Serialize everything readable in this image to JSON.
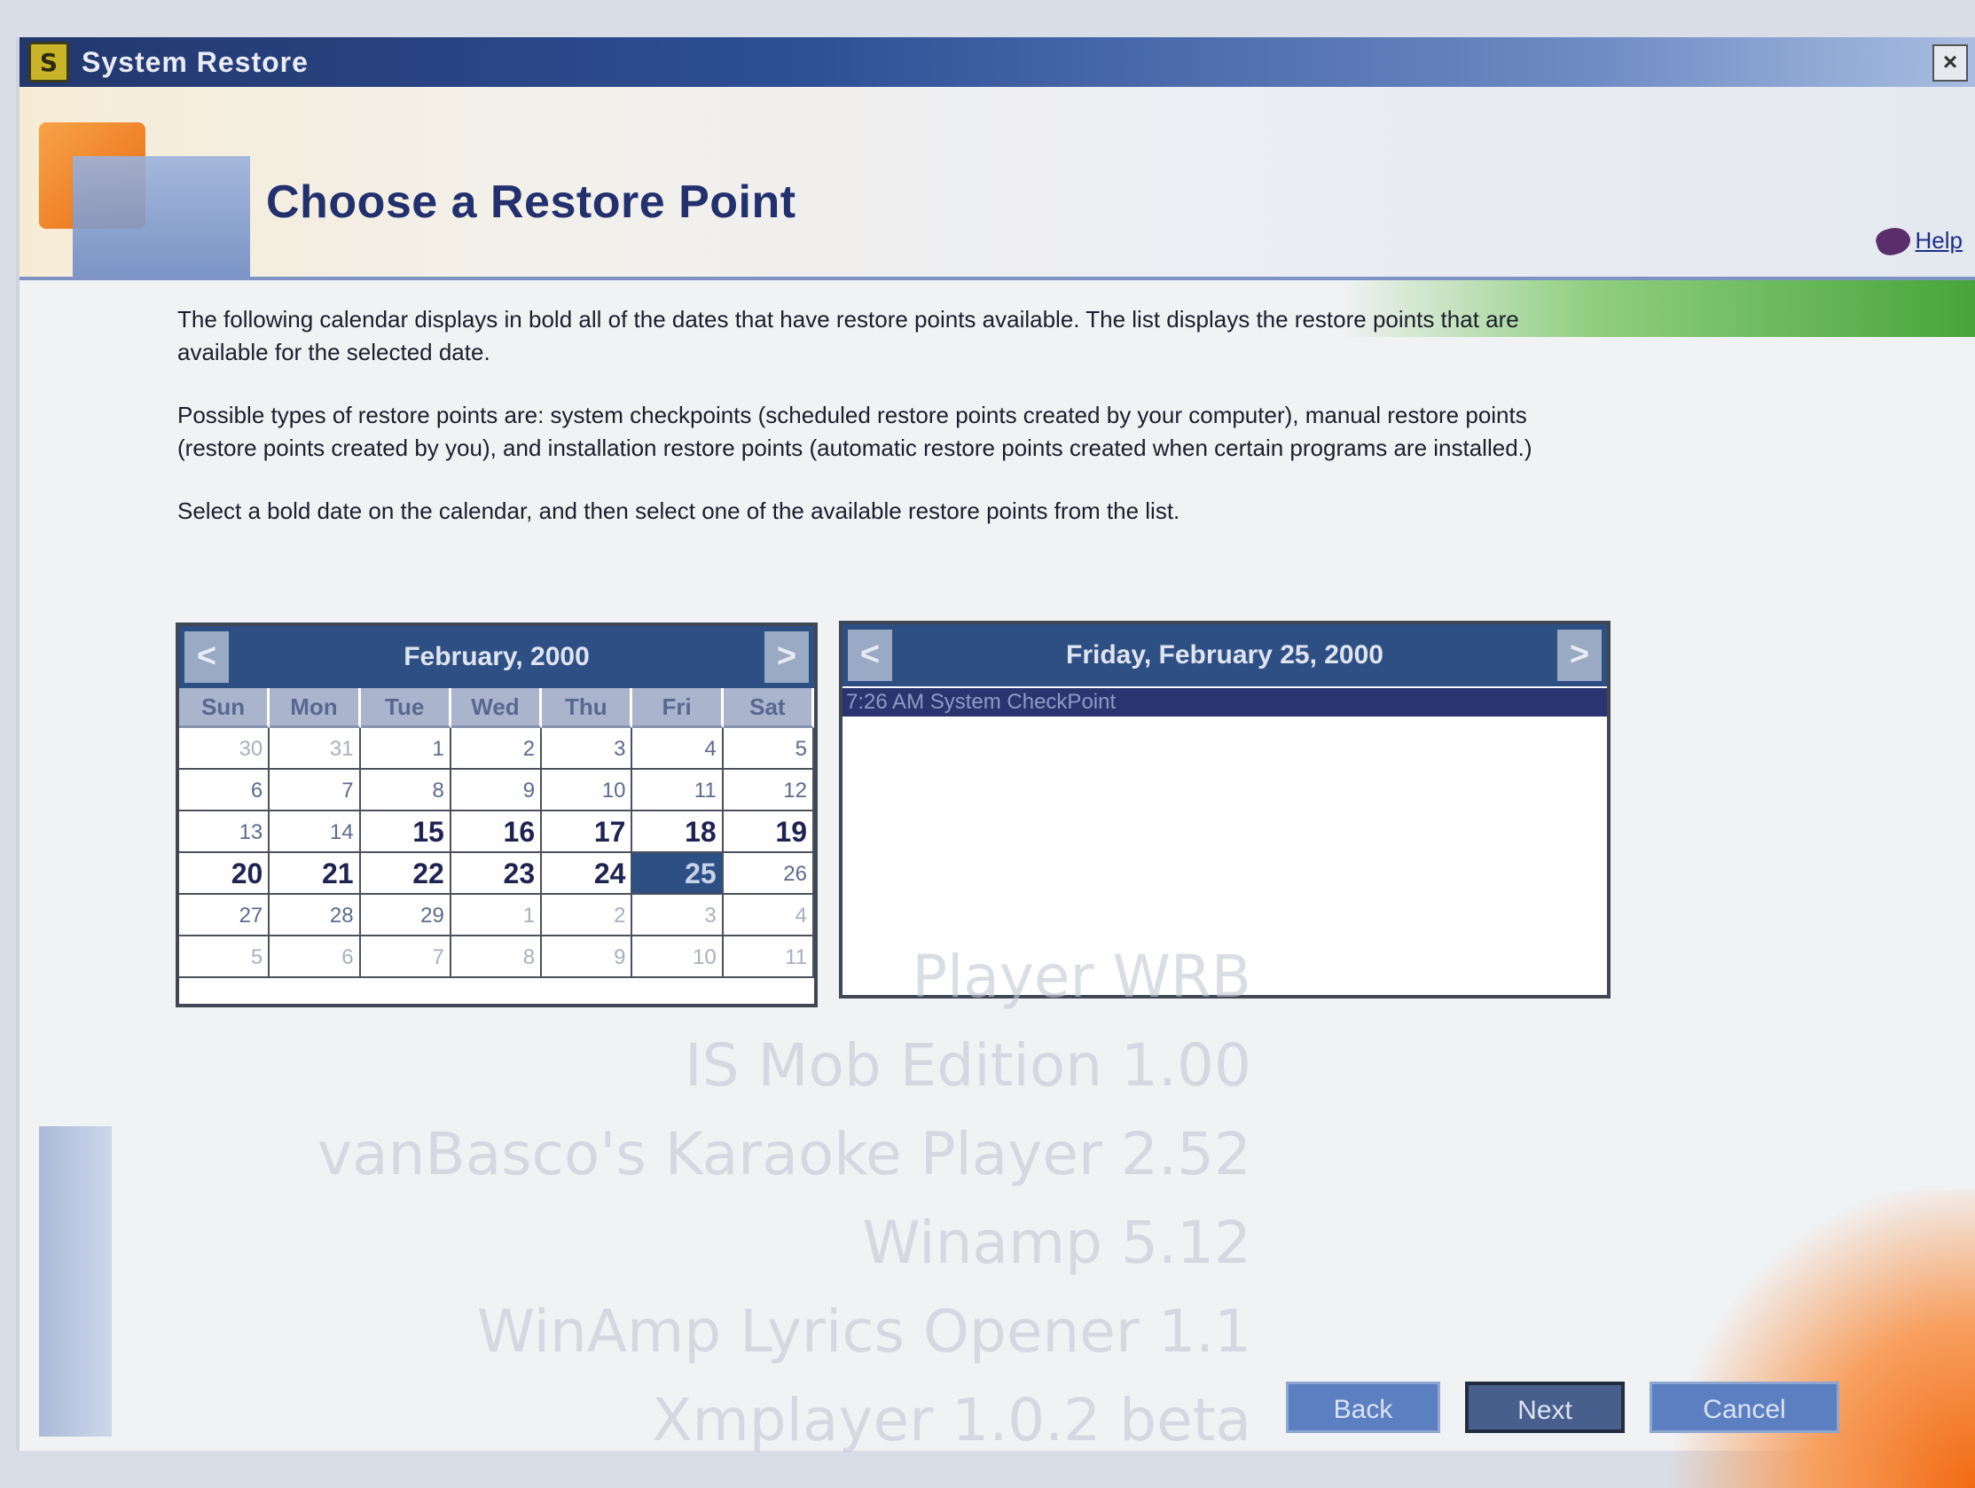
{
  "window": {
    "title": "System Restore",
    "close_label": "×"
  },
  "header": {
    "heading": "Choose a Restore Point",
    "help_label": "Help"
  },
  "instructions": [
    "The following calendar displays in bold all of the dates that have restore points available. The list displays the restore points that are available for the selected date.",
    "Possible types of restore points are: system checkpoints (scheduled restore points created by your computer), manual restore points (restore points created by you), and installation restore points (automatic restore points created when certain programs are installed.)",
    "Select a bold date on the calendar, and then select one of the available restore points from the list."
  ],
  "calendar": {
    "month_label": "February, 2000",
    "prev_label": "<",
    "next_label": ">",
    "weekdays": [
      "Sun",
      "Mon",
      "Tue",
      "Wed",
      "Thu",
      "Fri",
      "Sat"
    ],
    "days": [
      {
        "d": "30",
        "t": "other"
      },
      {
        "d": "31",
        "t": "other"
      },
      {
        "d": "1",
        "t": ""
      },
      {
        "d": "2",
        "t": ""
      },
      {
        "d": "3",
        "t": ""
      },
      {
        "d": "4",
        "t": ""
      },
      {
        "d": "5",
        "t": ""
      },
      {
        "d": "6",
        "t": ""
      },
      {
        "d": "7",
        "t": ""
      },
      {
        "d": "8",
        "t": ""
      },
      {
        "d": "9",
        "t": ""
      },
      {
        "d": "10",
        "t": ""
      },
      {
        "d": "11",
        "t": ""
      },
      {
        "d": "12",
        "t": ""
      },
      {
        "d": "13",
        "t": ""
      },
      {
        "d": "14",
        "t": ""
      },
      {
        "d": "15",
        "t": "bold"
      },
      {
        "d": "16",
        "t": "bold"
      },
      {
        "d": "17",
        "t": "bold"
      },
      {
        "d": "18",
        "t": "bold"
      },
      {
        "d": "19",
        "t": "bold"
      },
      {
        "d": "20",
        "t": "bold"
      },
      {
        "d": "21",
        "t": "bold"
      },
      {
        "d": "22",
        "t": "bold"
      },
      {
        "d": "23",
        "t": "bold"
      },
      {
        "d": "24",
        "t": "bold"
      },
      {
        "d": "25",
        "t": "sel"
      },
      {
        "d": "26",
        "t": ""
      },
      {
        "d": "27",
        "t": ""
      },
      {
        "d": "28",
        "t": ""
      },
      {
        "d": "29",
        "t": ""
      },
      {
        "d": "1",
        "t": "other"
      },
      {
        "d": "2",
        "t": "other"
      },
      {
        "d": "3",
        "t": "other"
      },
      {
        "d": "4",
        "t": "other"
      },
      {
        "d": "5",
        "t": "other"
      },
      {
        "d": "6",
        "t": "other"
      },
      {
        "d": "7",
        "t": "other"
      },
      {
        "d": "8",
        "t": "other"
      },
      {
        "d": "9",
        "t": "other"
      },
      {
        "d": "10",
        "t": "other"
      },
      {
        "d": "11",
        "t": "other"
      }
    ]
  },
  "restore_list": {
    "date_label": "Friday, February 25, 2000",
    "prev_label": "<",
    "next_label": ">",
    "items": [
      "7:26 AM System CheckPoint"
    ]
  },
  "buttons": {
    "back": "Back",
    "next": "Next",
    "cancel": "Cancel"
  },
  "background_text": [
    "Player WRB",
    "IS Mob Edition 1.00",
    "vanBasco's Karaoke Player 2.52",
    "Winamp 5.12",
    "WinAmp Lyrics Opener 1.1",
    "Xmplayer 1.0.2 beta"
  ],
  "colors": {
    "title_bar": "#2d4f95",
    "calendar_header": "#2d4f84",
    "selected_day": "#2d4f84",
    "heading_text": "#23306e",
    "button": "#5b7fc1"
  }
}
